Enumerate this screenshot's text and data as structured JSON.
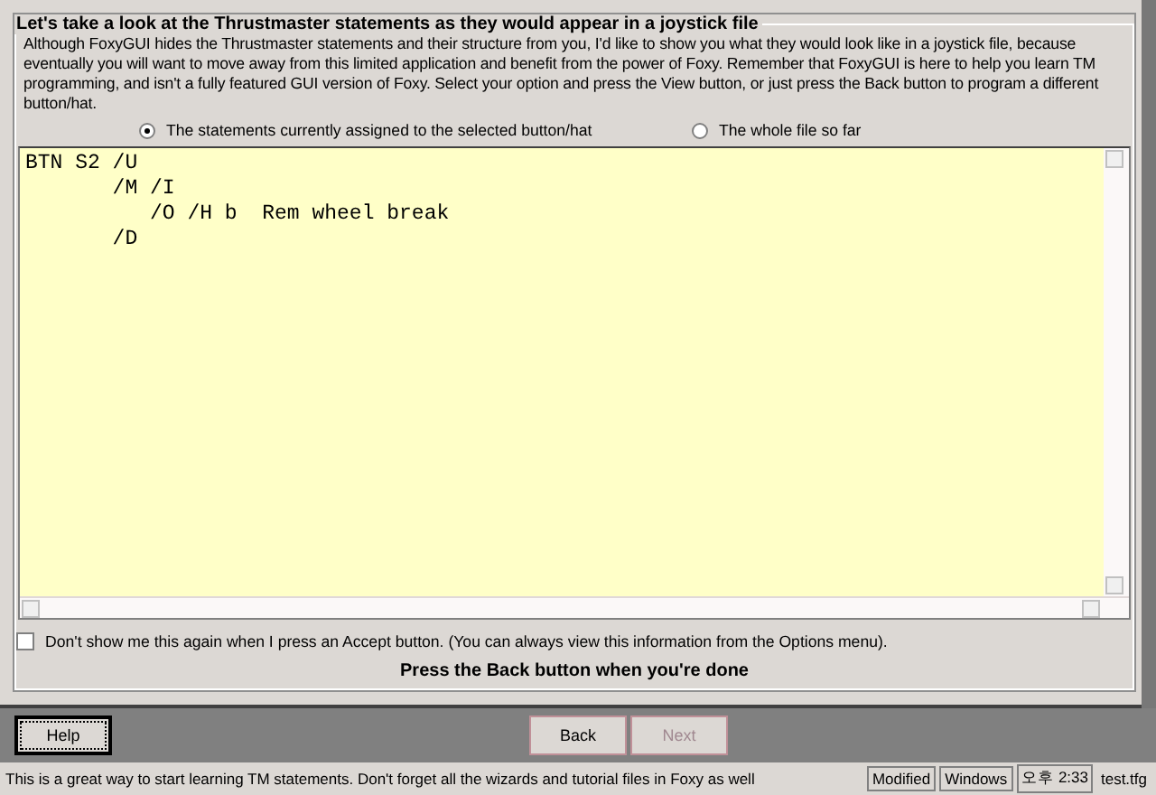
{
  "group": {
    "title": "Let's take a look at the Thrustmaster statements as they would appear in a joystick file"
  },
  "intro": "Although FoxyGUI hides the Thrustmaster statements and their structure from you, I'd like to show you what they would look like in a joystick file, because eventually you will want to move away from this limited application and benefit from the power of Foxy. Remember that FoxyGUI is here to help you learn TM programming, and isn't a fully featured GUI version of Foxy. Select your option and press the View button, or just press the Back button to program a different button/hat.",
  "options": [
    {
      "label": "The statements currently assigned to the selected button/hat",
      "selected": true
    },
    {
      "label": "The whole file so far",
      "selected": false
    }
  ],
  "code_lines": [
    "BTN S2 /U",
    "       /M /I",
    "          /O /H b  Rem wheel break",
    "       /D"
  ],
  "dont_show": {
    "label": "Don't show me this again when I press an Accept button. (You can always view this information from the Options menu).",
    "checked": false
  },
  "hint": "Press the Back button when you're done",
  "buttons": [
    {
      "label": "Help",
      "disabled": false
    },
    {
      "label": "Back",
      "disabled": false
    },
    {
      "label": "Next",
      "disabled": true
    }
  ],
  "status_bar": {
    "message": "This is a great way to start learning TM statements. Don't forget all the wizards and tutorial files in Foxy as well",
    "panels": [
      "Modified",
      "Windows",
      "오후 2:33",
      "test.tfg"
    ]
  }
}
